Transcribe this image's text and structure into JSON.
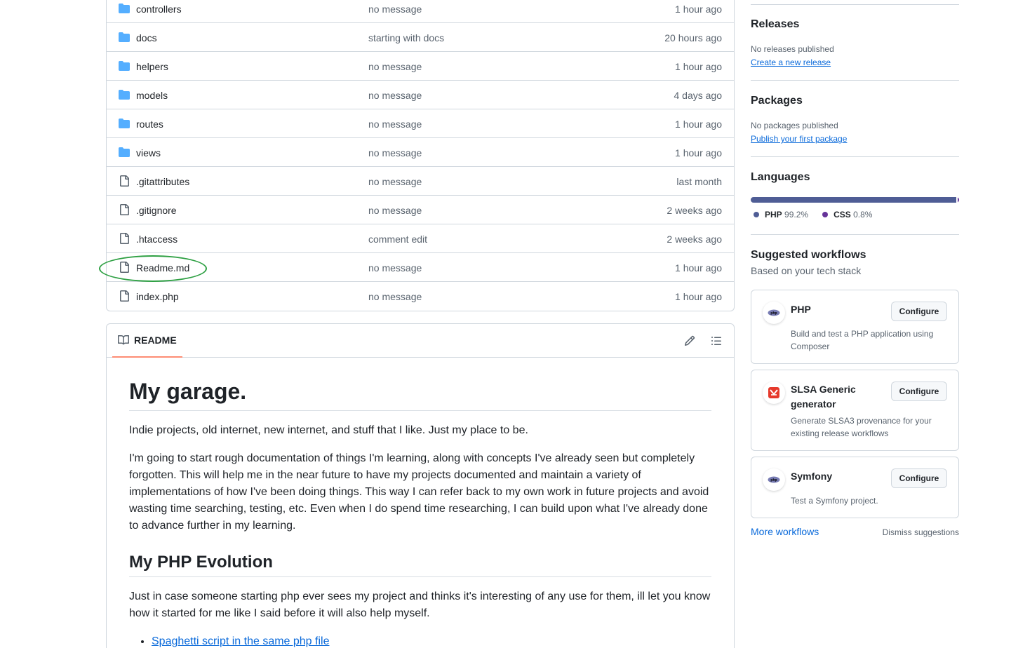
{
  "files": [
    {
      "name": "controllers",
      "type": "folder",
      "message": "no message",
      "time": "1 hour ago"
    },
    {
      "name": "docs",
      "type": "folder",
      "message": "starting with docs",
      "time": "20 hours ago"
    },
    {
      "name": "helpers",
      "type": "folder",
      "message": "no message",
      "time": "1 hour ago"
    },
    {
      "name": "models",
      "type": "folder",
      "message": "no message",
      "time": "4 days ago"
    },
    {
      "name": "routes",
      "type": "folder",
      "message": "no message",
      "time": "1 hour ago"
    },
    {
      "name": "views",
      "type": "folder",
      "message": "no message",
      "time": "1 hour ago"
    },
    {
      "name": ".gitattributes",
      "type": "file",
      "message": "no message",
      "time": "last month"
    },
    {
      "name": ".gitignore",
      "type": "file",
      "message": "no message",
      "time": "2 weeks ago"
    },
    {
      "name": ".htaccess",
      "type": "file",
      "message": "comment edit",
      "time": "2 weeks ago"
    },
    {
      "name": "Readme.md",
      "type": "file",
      "message": "no message",
      "time": "1 hour ago"
    },
    {
      "name": "index.php",
      "type": "file",
      "message": "no message",
      "time": "1 hour ago"
    }
  ],
  "readme": {
    "tab_label": "README",
    "h1": "My garage.",
    "p1": "Indie projects, old internet, new internet, and stuff that I like. Just my place to be.",
    "p2": "I'm going to start rough documentation of things I'm learning, along with concepts I've already seen but completely forgotten. This will help me in the near future to have my projects documented and maintain a variety of implementations of how I've been doing things. This way I can refer back to my own work in future projects and avoid wasting time searching, testing, etc. Even when I do spend time researching, I can build upon what I've already done to advance further in my learning.",
    "h2": "My PHP Evolution",
    "p3": "Just in case someone starting php ever sees my project and thinks it's interesting of any use for them, ill let you know how it started for me like I said before it will also help myself.",
    "list": [
      "Spaghetti script in the same php file"
    ]
  },
  "sidebar": {
    "releases": {
      "title": "Releases",
      "empty": "No releases published",
      "link": "Create a new release"
    },
    "packages": {
      "title": "Packages",
      "empty": "No packages published",
      "link": "Publish your first package"
    },
    "languages": {
      "title": "Languages",
      "items": [
        {
          "name": "PHP",
          "percent": "99.2%",
          "value": 99.2,
          "color": "#4F5D95"
        },
        {
          "name": "CSS",
          "percent": "0.8%",
          "value": 0.8,
          "color": "#663399"
        }
      ]
    },
    "workflows": {
      "title": "Suggested workflows",
      "subtitle": "Based on your tech stack",
      "cards": [
        {
          "title": "PHP",
          "desc": "Build and test a PHP application using Composer",
          "button": "Configure",
          "icon": "php-logo-icon"
        },
        {
          "title": "SLSA Generic generator",
          "desc": "Generate SLSA3 provenance for your existing release workflows",
          "button": "Configure",
          "icon": "slsa-logo-icon"
        },
        {
          "title": "Symfony",
          "desc": "Test a Symfony project.",
          "button": "Configure",
          "icon": "php-logo-icon"
        }
      ],
      "more": "More workflows",
      "dismiss": "Dismiss suggestions"
    }
  },
  "colors": {
    "accent": "#0969da",
    "folder": "#54aeff",
    "highlight": "#2ea043"
  }
}
